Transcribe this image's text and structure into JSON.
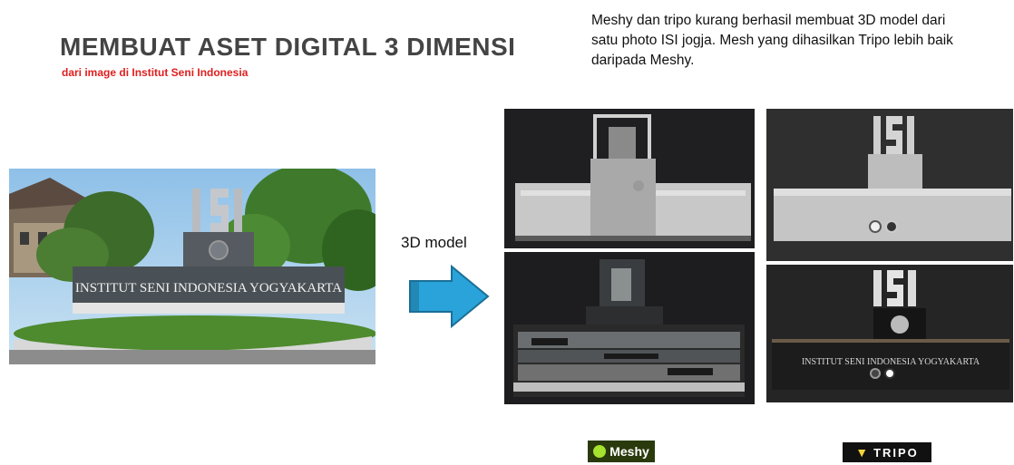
{
  "header": {
    "title": "MEMBUAT ASET DIGITAL 3 DIMENSI",
    "subtitle": "dari image di Institut Seni Indonesia"
  },
  "description": "Meshy dan tripo kurang berhasil membuat 3D model dari satu photo ISI jogja. Mesh yang dihasilkan Tripo lebih baik daripada Meshy.",
  "photo": {
    "sign_text": "INSTITUT SENI INDONESIA YOGYAKARTA",
    "letters": "ISI"
  },
  "arrow": {
    "label": "3D model",
    "color": "#29a3d9"
  },
  "tripo_model": {
    "engraved_text": "INSTITUT SENI INDONESIA YOGYAKARTA"
  },
  "logos": {
    "meshy": "Meshy",
    "tripo": "TRIPO"
  }
}
